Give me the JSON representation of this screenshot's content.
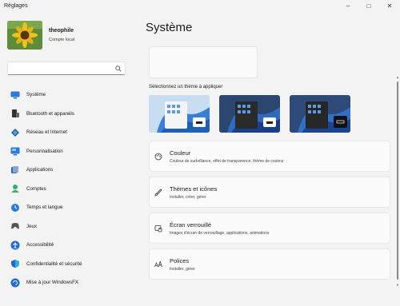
{
  "window": {
    "title": "Réglages"
  },
  "profile": {
    "username": "theophile",
    "account": "Compte local"
  },
  "search": {
    "placeholder": "",
    "value": ""
  },
  "sidebar": {
    "items": [
      {
        "label": "Système",
        "icon": "display-icon",
        "color": "#2b7bd8"
      },
      {
        "label": "Bluetooth et appareils",
        "icon": "bluetooth-devices-icon",
        "color": "#333333"
      },
      {
        "label": "Réseau et Internet",
        "icon": "network-icon",
        "color": "#1f5fa8"
      },
      {
        "label": "Personnalisation",
        "icon": "personalization-icon",
        "color": "#2b7bd8"
      },
      {
        "label": "Applications",
        "icon": "apps-icon",
        "color": "#3a6db0"
      },
      {
        "label": "Comptes",
        "icon": "accounts-icon",
        "color": "#2eb36f"
      },
      {
        "label": "Temps et langue",
        "icon": "time-language-icon",
        "color": "#2b7bd8"
      },
      {
        "label": "Jeux",
        "icon": "games-icon",
        "color": "#555555"
      },
      {
        "label": "Accessibilité",
        "icon": "accessibility-icon",
        "color": "#1f6ad1"
      },
      {
        "label": "Confidentialité et sécurité",
        "icon": "shield-icon",
        "color": "#1f6ad1"
      },
      {
        "label": "Mise à jour WindowsFX",
        "icon": "update-icon",
        "color": "#1f6ad1"
      }
    ]
  },
  "main": {
    "title": "Système",
    "theme_label": "Sélectionnez un thème à appliquer",
    "cards": [
      {
        "title": "Couleur",
        "subtitle": "Couleur de surbrillance, effet de transparence, thème de couleur",
        "icon": "palette-icon"
      },
      {
        "title": "Thèmes et icônes",
        "subtitle": "Installer, créer, gérer",
        "icon": "brush-icon"
      },
      {
        "title": "Écran verrouillé",
        "subtitle": "Images d'écran de verrouillage, applications, animations",
        "icon": "lock-screen-icon"
      },
      {
        "title": "Polices",
        "subtitle": "Installer, gérer",
        "icon": "fonts-icon"
      }
    ]
  }
}
